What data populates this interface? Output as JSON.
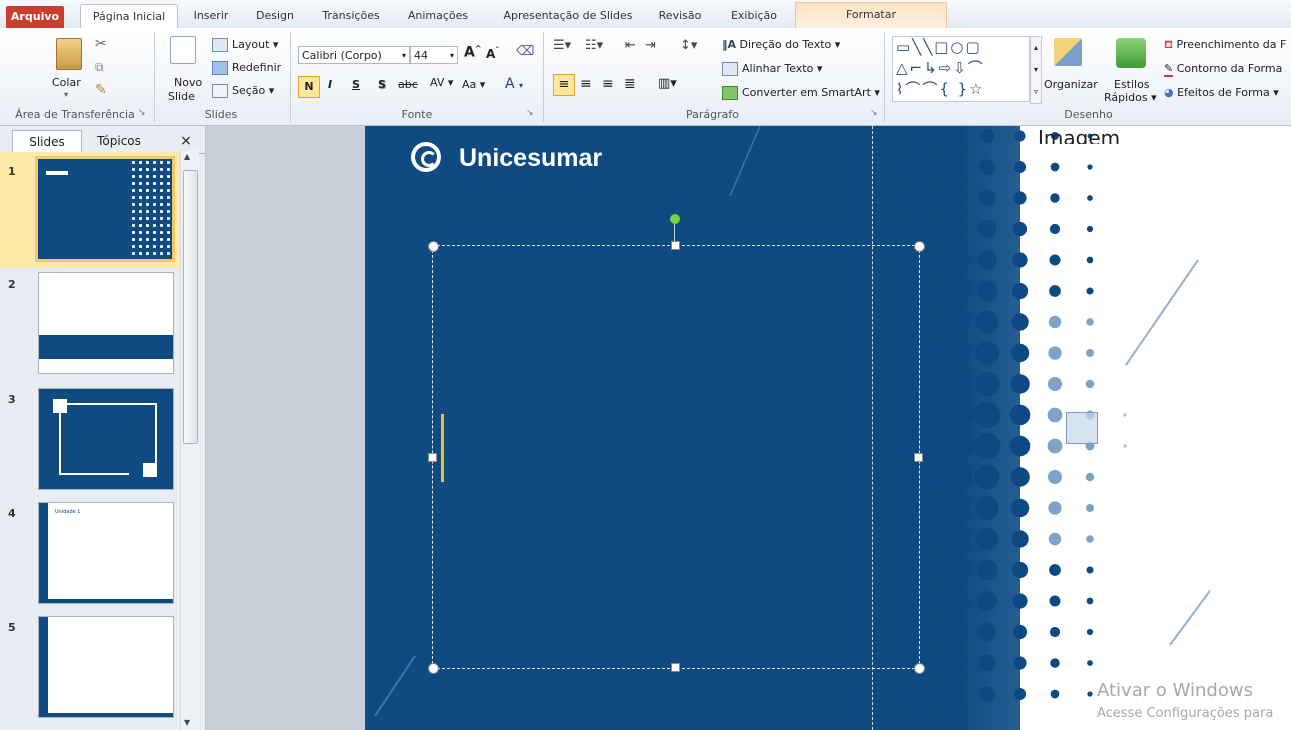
{
  "tabs": {
    "file": "Arquivo",
    "home": "Página Inicial",
    "insert": "Inserir",
    "design": "Design",
    "transitions": "Transições",
    "animations": "Animações",
    "slideshow": "Apresentação de Slides",
    "review": "Revisão",
    "view": "Exibição",
    "format": "Formatar"
  },
  "clipboard": {
    "paste": "Colar",
    "label": "Área de Transferência"
  },
  "slides_group": {
    "new_slide": "Novo",
    "new_slide2": "Slide",
    "layout": "Layout",
    "reset": "Redefinir",
    "section": "Seção",
    "label": "Slides"
  },
  "font_group": {
    "font_name": "Calibri (Corpo)",
    "font_size": "44",
    "bold": "N",
    "italic": "I",
    "underline": "S",
    "shadow": "S",
    "strike": "abc",
    "spacing": "AV",
    "case": "Aa",
    "color": "A",
    "label": "Fonte"
  },
  "paragraph_group": {
    "text_direction": "Direção do Texto",
    "align_text": "Alinhar Texto",
    "smartart": "Converter em SmartArt",
    "label": "Parágrafo"
  },
  "drawing_group": {
    "arrange": "Organizar",
    "quick_styles": "Estilos",
    "quick_styles2": "Rápidos",
    "fill": "Preenchimento da F",
    "outline": "Contorno da Forma",
    "effects": "Efeitos de Forma",
    "label": "Desenho"
  },
  "panel": {
    "tab_slides": "Slides",
    "tab_outline": "Tópicos",
    "close": "×"
  },
  "thumbnails": [
    {
      "num": "1"
    },
    {
      "num": "2"
    },
    {
      "num": "3"
    },
    {
      "num": "4",
      "text": "Unidade 1"
    },
    {
      "num": "5"
    }
  ],
  "slide": {
    "logo_text": "Unicesumar",
    "image_placeholder": "Imagem"
  },
  "watermark": {
    "line1": "Ativar o Windows",
    "line2": "Acesse Configurações para"
  },
  "colors": {
    "slide_blue": "#0f4a80",
    "file_tab": "#c8402d",
    "handle_green": "#7ed13b",
    "cursor_yellow": "#e5c12a"
  }
}
